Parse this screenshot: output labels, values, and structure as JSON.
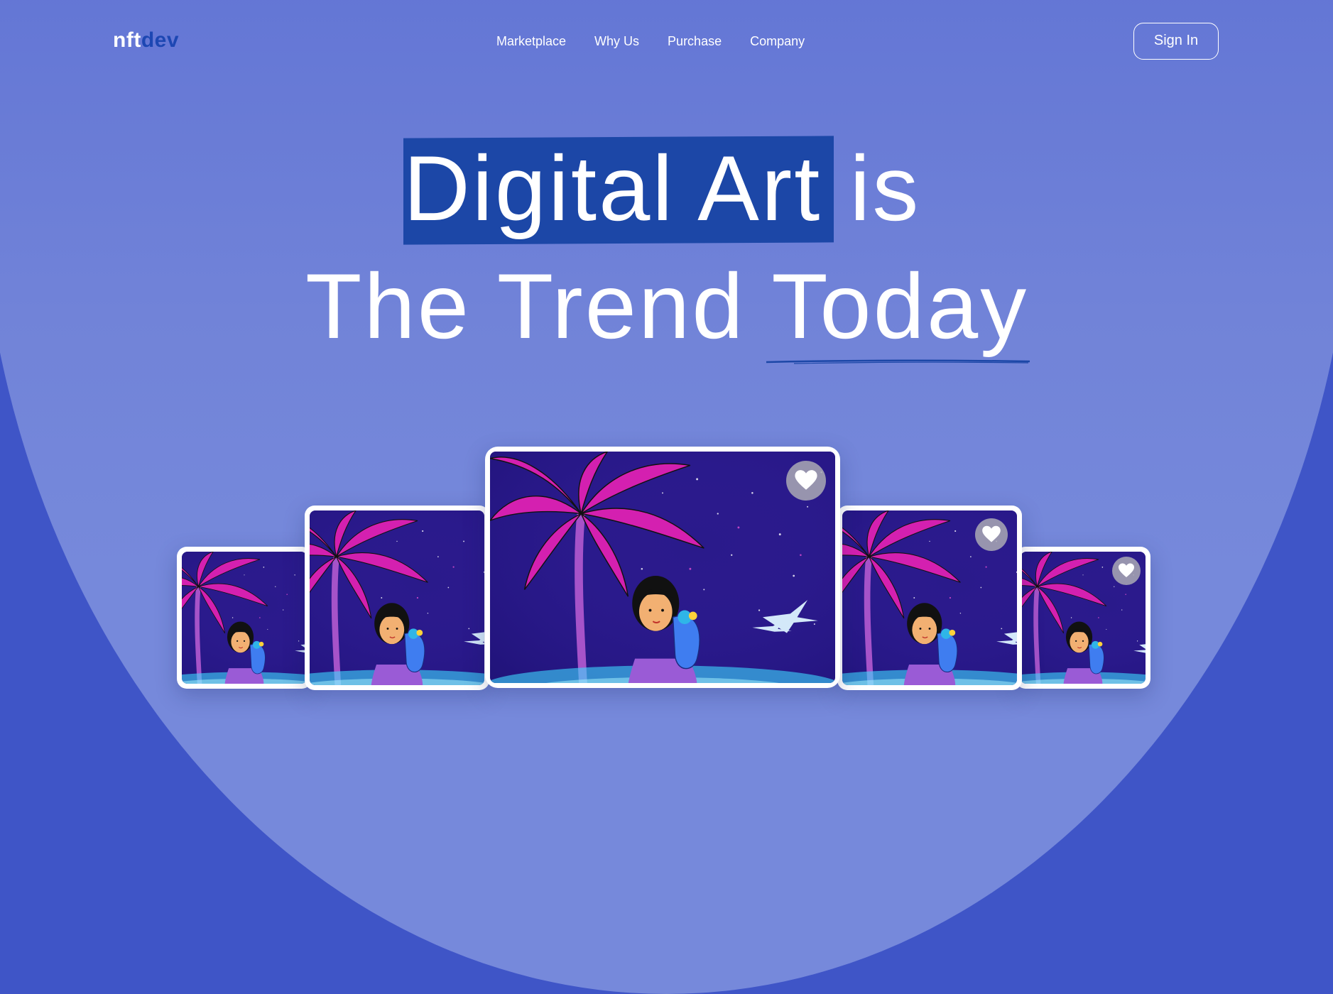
{
  "brand": {
    "name_part1": "nft",
    "name_part2": "dev"
  },
  "nav": {
    "items": [
      "Marketplace",
      "Why Us",
      "Purchase",
      "Company"
    ]
  },
  "header": {
    "signin_label": "Sign In"
  },
  "hero": {
    "highlight": "Digital Art",
    "line1_rest": " is",
    "line2_part1": "The Trend ",
    "line2_underlined": "Today"
  },
  "colors": {
    "background": "#3f55c7",
    "highlight": "#1c47a7",
    "accent": "#1d47b3"
  },
  "cards": [
    {
      "name": "card-far-left",
      "favorite_icon": false
    },
    {
      "name": "card-left",
      "favorite_icon": false
    },
    {
      "name": "card-center",
      "favorite_icon": "heart-icon"
    },
    {
      "name": "card-right",
      "favorite_icon": "heart-icon"
    },
    {
      "name": "card-far-right",
      "favorite_icon": "heart-icon"
    }
  ]
}
